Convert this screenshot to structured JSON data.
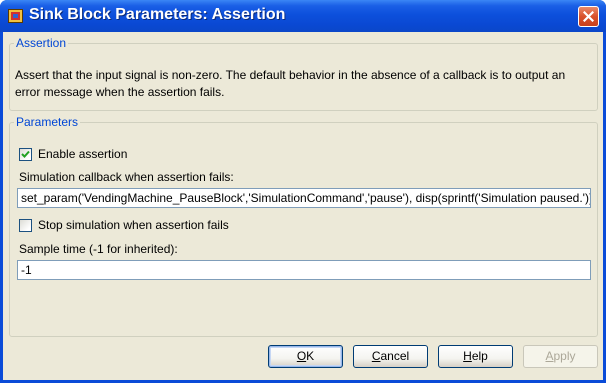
{
  "window": {
    "title": "Sink Block Parameters: Assertion"
  },
  "assertion_group": {
    "legend": "Assertion",
    "description": "Assert that the input signal is non-zero.  The default behavior in the absence of a callback is to output an error message when the assertion fails."
  },
  "parameters_group": {
    "legend": "Parameters",
    "enable_assertion": {
      "label": "Enable assertion",
      "checked": true
    },
    "callback_label": "Simulation callback when assertion fails:",
    "callback_value": "set_param('VendingMachine_PauseBlock','SimulationCommand','pause'), disp(sprintf('Simulation paused.'))",
    "stop_simulation": {
      "label": "Stop simulation when assertion fails",
      "checked": false
    },
    "sample_time_label": "Sample time (-1 for inherited):",
    "sample_time_value": "-1"
  },
  "buttons": {
    "ok": {
      "prefix": "",
      "mnemonic": "O",
      "suffix": "K"
    },
    "cancel": {
      "prefix": "",
      "mnemonic": "C",
      "suffix": "ancel"
    },
    "help": {
      "prefix": "",
      "mnemonic": "H",
      "suffix": "elp"
    },
    "apply": {
      "prefix": "",
      "mnemonic": "A",
      "suffix": "pply",
      "enabled": false
    }
  },
  "colors": {
    "titlebar": "#0a48d2",
    "dialog_bg": "#ece9d8",
    "legend_text": "#0046d5",
    "close_button": "#d9512b"
  },
  "icons": {
    "title": "simulink-block-icon",
    "close": "close-x-icon",
    "check": "checkmark-icon"
  }
}
